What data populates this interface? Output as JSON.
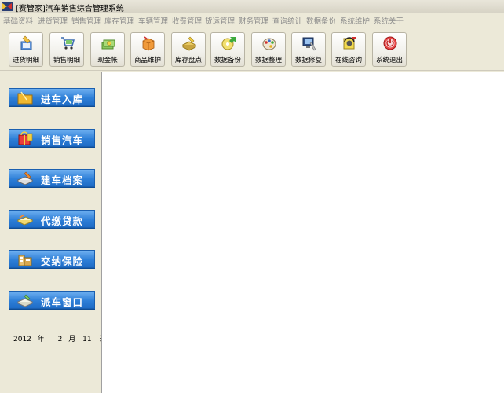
{
  "window": {
    "title": "[赛管家]汽车销售综合管理系统"
  },
  "menu": [
    "基础资料",
    "进货管理",
    "销售管理",
    "库存管理",
    "车辆管理",
    "收费管理",
    "货运管理",
    "财务管理",
    "查询统计",
    "数据备份",
    "系统维护",
    "系统关于"
  ],
  "toolbar": [
    {
      "label": "进货明细",
      "icon": "pen-notepad-icon"
    },
    {
      "label": "销售明细",
      "icon": "cart-icon"
    },
    {
      "label": "现金帐",
      "icon": "cash-icon"
    },
    {
      "label": "商品维护",
      "icon": "box-icon"
    },
    {
      "label": "库存盘点",
      "icon": "inventory-icon"
    },
    {
      "label": "数据备份",
      "icon": "disc-arrow-icon"
    },
    {
      "label": "数据整理",
      "icon": "palette-icon"
    },
    {
      "label": "数据修复",
      "icon": "monitor-tools-icon"
    },
    {
      "label": "在线咨询",
      "icon": "headset-icon"
    },
    {
      "label": "系统退出",
      "icon": "power-icon"
    }
  ],
  "nav": [
    {
      "label": "进车入库",
      "icon": "folder-icon"
    },
    {
      "label": "销售汽车",
      "icon": "gift-bag-icon"
    },
    {
      "label": "建车档案",
      "icon": "book-pen-icon"
    },
    {
      "label": "代缴贷款",
      "icon": "notepad-icon"
    },
    {
      "label": "交纳保险",
      "icon": "building-icon"
    },
    {
      "label": "派车窗口",
      "icon": "truck-window-icon"
    }
  ],
  "date": {
    "year": "2012",
    "year_unit": "年",
    "month": "2",
    "month_unit": "月",
    "day": "11",
    "day_unit": "日"
  }
}
